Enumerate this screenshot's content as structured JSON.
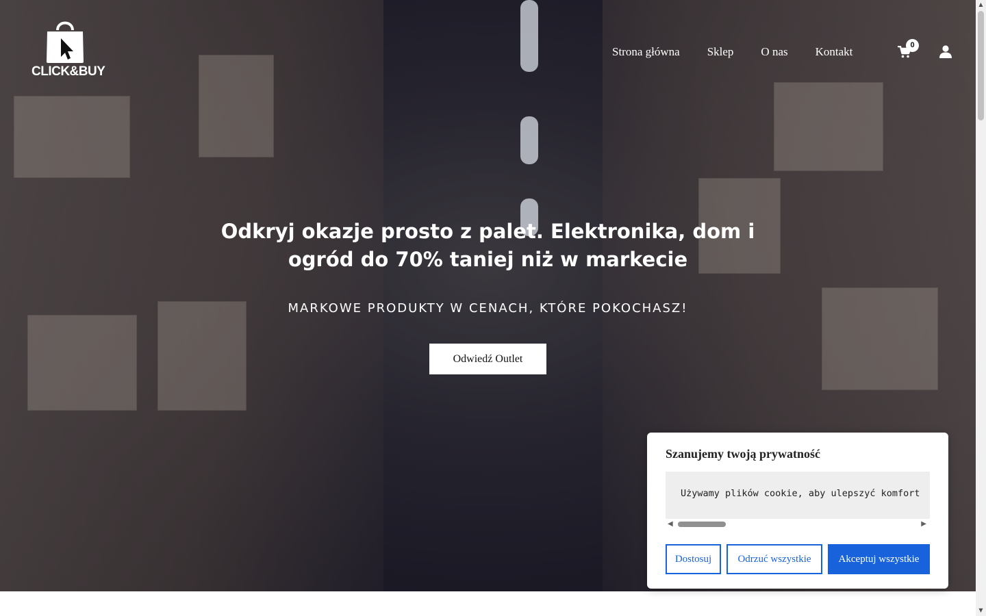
{
  "header": {
    "logo_text": "CLICK&BUY",
    "nav": [
      "Strona główna",
      "Sklep",
      "O nas",
      "Kontakt"
    ],
    "cart_count": "0"
  },
  "hero": {
    "title": "Odkryj okazje prosto z palet. Elektronika, dom i ogród do 70% taniej niż w markecie",
    "subtitle": "MARKOWE PRODUKTY W CENACH, KTÓRE POKOCHASZ!",
    "cta": "Odwiedź Outlet"
  },
  "cookie": {
    "title": "Szanujemy twoją prywatność",
    "text": "Używamy plików cookie, aby ulepszyć komfort",
    "customize": "Dostosuj",
    "reject": "Odrzuć wszystkie",
    "accept": "Akceptuj wszystkie"
  },
  "colors": {
    "accent": "#1863dc",
    "text_light": "#ffffff"
  },
  "icons": [
    "shopping-bag-logo-icon",
    "cart-icon",
    "user-icon"
  ]
}
